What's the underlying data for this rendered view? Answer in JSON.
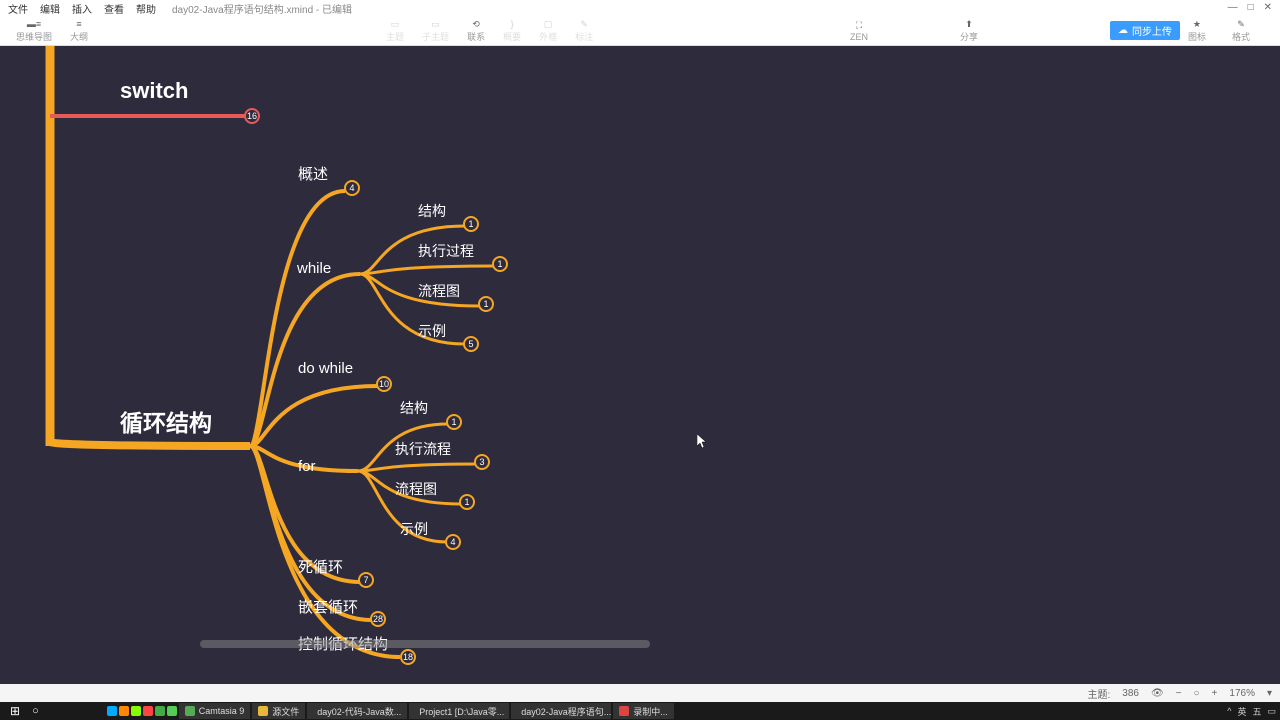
{
  "menu": {
    "file": "文件",
    "edit": "编辑",
    "insert": "插入",
    "view": "查看",
    "help": "帮助",
    "title": "day02-Java程序语句结构.xmind - 已编辑"
  },
  "toolbar": {
    "mindmap": "思维导图",
    "outline": "大纲",
    "topic": "主题",
    "subtopic": "子主题",
    "relation": "联系",
    "summary": "概要",
    "boundary": "外框",
    "marker": "标注",
    "zen": "ZEN",
    "share": "分享",
    "cloud": "同步上传",
    "icon": "图标",
    "style": "格式"
  },
  "mindmap": {
    "switch": {
      "label": "switch",
      "badge": "16"
    },
    "loop": {
      "label": "循环结构"
    },
    "overview": {
      "label": "概述",
      "badge": "4"
    },
    "while": {
      "label": "while",
      "children": [
        {
          "label": "结构",
          "badge": "1"
        },
        {
          "label": "执行过程",
          "badge": "1"
        },
        {
          "label": "流程图",
          "badge": "1"
        },
        {
          "label": "示例",
          "badge": "5"
        }
      ]
    },
    "dowhile": {
      "label": "do while",
      "badge": "10"
    },
    "for": {
      "label": "for",
      "children": [
        {
          "label": "结构",
          "badge": "1"
        },
        {
          "label": "执行流程",
          "badge": "3"
        },
        {
          "label": "流程图",
          "badge": "1"
        },
        {
          "label": "示例",
          "badge": "4"
        }
      ]
    },
    "infinite": {
      "label": "死循环",
      "badge": "7"
    },
    "nested": {
      "label": "嵌套循环",
      "badge": "28"
    },
    "control": {
      "label": "控制循环结构",
      "badge": "18"
    }
  },
  "status": {
    "topic_label": "主题:",
    "topic_count": "386",
    "zoom": "176%"
  },
  "taskbar": {
    "items": [
      {
        "label": "Camtasia 9",
        "color": "#5a5"
      },
      {
        "label": "源文件",
        "color": "#e8b83b"
      },
      {
        "label": "day02-代码-Java数...",
        "color": "#d44"
      },
      {
        "label": "Project1 [D:\\Java零...",
        "color": "#333"
      },
      {
        "label": "day02-Java程序语句...",
        "color": "#d44"
      },
      {
        "label": "录制中...",
        "color": "#d44"
      }
    ],
    "tray": {
      "ime": "英",
      "lang": "五"
    }
  },
  "colors": {
    "orange": "#f5a623",
    "red": "#e85a5a",
    "badge_border": "#f5a623"
  }
}
